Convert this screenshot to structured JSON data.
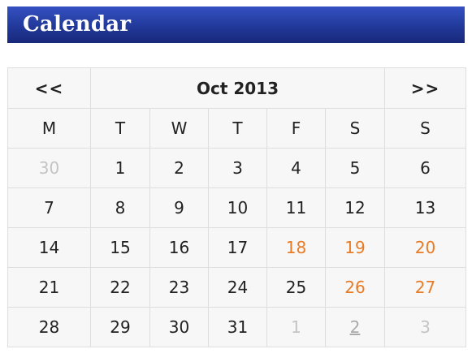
{
  "header": {
    "title": "Calendar"
  },
  "calendar": {
    "prev_label": "<<",
    "next_label": ">>",
    "month_label": "Oct 2013",
    "weekdays": [
      "M",
      "T",
      "W",
      "T",
      "F",
      "S",
      "S"
    ],
    "weeks": [
      [
        {
          "day": "30",
          "state": "other"
        },
        {
          "day": "1",
          "state": "normal"
        },
        {
          "day": "2",
          "state": "normal"
        },
        {
          "day": "3",
          "state": "normal"
        },
        {
          "day": "4",
          "state": "normal"
        },
        {
          "day": "5",
          "state": "normal"
        },
        {
          "day": "6",
          "state": "normal"
        }
      ],
      [
        {
          "day": "7",
          "state": "normal"
        },
        {
          "day": "8",
          "state": "normal"
        },
        {
          "day": "9",
          "state": "normal"
        },
        {
          "day": "10",
          "state": "normal"
        },
        {
          "day": "11",
          "state": "normal"
        },
        {
          "day": "12",
          "state": "normal"
        },
        {
          "day": "13",
          "state": "normal"
        }
      ],
      [
        {
          "day": "14",
          "state": "normal"
        },
        {
          "day": "15",
          "state": "normal"
        },
        {
          "day": "16",
          "state": "normal"
        },
        {
          "day": "17",
          "state": "normal"
        },
        {
          "day": "18",
          "state": "highlight"
        },
        {
          "day": "19",
          "state": "highlight"
        },
        {
          "day": "20",
          "state": "highlight"
        }
      ],
      [
        {
          "day": "21",
          "state": "normal"
        },
        {
          "day": "22",
          "state": "normal"
        },
        {
          "day": "23",
          "state": "normal"
        },
        {
          "day": "24",
          "state": "normal"
        },
        {
          "day": "25",
          "state": "normal"
        },
        {
          "day": "26",
          "state": "highlight"
        },
        {
          "day": "27",
          "state": "highlight"
        }
      ],
      [
        {
          "day": "28",
          "state": "normal"
        },
        {
          "day": "29",
          "state": "normal"
        },
        {
          "day": "30",
          "state": "normal"
        },
        {
          "day": "31",
          "state": "normal"
        },
        {
          "day": "1",
          "state": "other"
        },
        {
          "day": "2",
          "state": "other-underlined"
        },
        {
          "day": "3",
          "state": "other"
        }
      ]
    ]
  },
  "colors": {
    "header_gradient_top": "#3551c2",
    "header_gradient_bottom": "#18287a",
    "header_text": "#ffffff",
    "grid_background": "#f7f7f7",
    "grid_border": "#dedede",
    "nav_arrow": "#1f3a56",
    "day_text": "#222222",
    "other_month_text": "#c4c4c4",
    "highlight_text": "#e87b25"
  }
}
